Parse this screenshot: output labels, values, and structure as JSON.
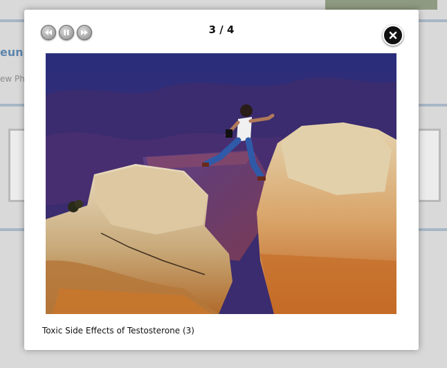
{
  "lightbox": {
    "counter": "3 / 4",
    "caption": "Toxic Side Effects of Testosterone (3)"
  },
  "controls": {
    "previous": "previous-icon",
    "pause": "pause-icon",
    "next": "next-icon",
    "close": "close-icon"
  },
  "background_page": {
    "heading_fragment": "euni",
    "subtext_fragment": "ew Ph"
  }
}
